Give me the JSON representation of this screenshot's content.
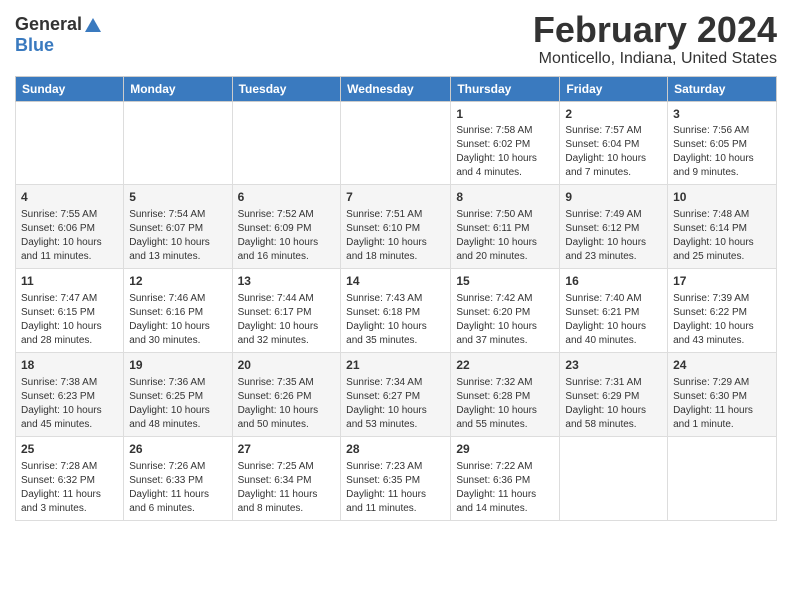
{
  "logo": {
    "general": "General",
    "blue": "Blue"
  },
  "title": "February 2024",
  "subtitle": "Monticello, Indiana, United States",
  "days_of_week": [
    "Sunday",
    "Monday",
    "Tuesday",
    "Wednesday",
    "Thursday",
    "Friday",
    "Saturday"
  ],
  "weeks": [
    [
      {
        "day": "",
        "info": ""
      },
      {
        "day": "",
        "info": ""
      },
      {
        "day": "",
        "info": ""
      },
      {
        "day": "",
        "info": ""
      },
      {
        "day": "1",
        "info": "Sunrise: 7:58 AM\nSunset: 6:02 PM\nDaylight: 10 hours\nand 4 minutes."
      },
      {
        "day": "2",
        "info": "Sunrise: 7:57 AM\nSunset: 6:04 PM\nDaylight: 10 hours\nand 7 minutes."
      },
      {
        "day": "3",
        "info": "Sunrise: 7:56 AM\nSunset: 6:05 PM\nDaylight: 10 hours\nand 9 minutes."
      }
    ],
    [
      {
        "day": "4",
        "info": "Sunrise: 7:55 AM\nSunset: 6:06 PM\nDaylight: 10 hours\nand 11 minutes."
      },
      {
        "day": "5",
        "info": "Sunrise: 7:54 AM\nSunset: 6:07 PM\nDaylight: 10 hours\nand 13 minutes."
      },
      {
        "day": "6",
        "info": "Sunrise: 7:52 AM\nSunset: 6:09 PM\nDaylight: 10 hours\nand 16 minutes."
      },
      {
        "day": "7",
        "info": "Sunrise: 7:51 AM\nSunset: 6:10 PM\nDaylight: 10 hours\nand 18 minutes."
      },
      {
        "day": "8",
        "info": "Sunrise: 7:50 AM\nSunset: 6:11 PM\nDaylight: 10 hours\nand 20 minutes."
      },
      {
        "day": "9",
        "info": "Sunrise: 7:49 AM\nSunset: 6:12 PM\nDaylight: 10 hours\nand 23 minutes."
      },
      {
        "day": "10",
        "info": "Sunrise: 7:48 AM\nSunset: 6:14 PM\nDaylight: 10 hours\nand 25 minutes."
      }
    ],
    [
      {
        "day": "11",
        "info": "Sunrise: 7:47 AM\nSunset: 6:15 PM\nDaylight: 10 hours\nand 28 minutes."
      },
      {
        "day": "12",
        "info": "Sunrise: 7:46 AM\nSunset: 6:16 PM\nDaylight: 10 hours\nand 30 minutes."
      },
      {
        "day": "13",
        "info": "Sunrise: 7:44 AM\nSunset: 6:17 PM\nDaylight: 10 hours\nand 32 minutes."
      },
      {
        "day": "14",
        "info": "Sunrise: 7:43 AM\nSunset: 6:18 PM\nDaylight: 10 hours\nand 35 minutes."
      },
      {
        "day": "15",
        "info": "Sunrise: 7:42 AM\nSunset: 6:20 PM\nDaylight: 10 hours\nand 37 minutes."
      },
      {
        "day": "16",
        "info": "Sunrise: 7:40 AM\nSunset: 6:21 PM\nDaylight: 10 hours\nand 40 minutes."
      },
      {
        "day": "17",
        "info": "Sunrise: 7:39 AM\nSunset: 6:22 PM\nDaylight: 10 hours\nand 43 minutes."
      }
    ],
    [
      {
        "day": "18",
        "info": "Sunrise: 7:38 AM\nSunset: 6:23 PM\nDaylight: 10 hours\nand 45 minutes."
      },
      {
        "day": "19",
        "info": "Sunrise: 7:36 AM\nSunset: 6:25 PM\nDaylight: 10 hours\nand 48 minutes."
      },
      {
        "day": "20",
        "info": "Sunrise: 7:35 AM\nSunset: 6:26 PM\nDaylight: 10 hours\nand 50 minutes."
      },
      {
        "day": "21",
        "info": "Sunrise: 7:34 AM\nSunset: 6:27 PM\nDaylight: 10 hours\nand 53 minutes."
      },
      {
        "day": "22",
        "info": "Sunrise: 7:32 AM\nSunset: 6:28 PM\nDaylight: 10 hours\nand 55 minutes."
      },
      {
        "day": "23",
        "info": "Sunrise: 7:31 AM\nSunset: 6:29 PM\nDaylight: 10 hours\nand 58 minutes."
      },
      {
        "day": "24",
        "info": "Sunrise: 7:29 AM\nSunset: 6:30 PM\nDaylight: 11 hours\nand 1 minute."
      }
    ],
    [
      {
        "day": "25",
        "info": "Sunrise: 7:28 AM\nSunset: 6:32 PM\nDaylight: 11 hours\nand 3 minutes."
      },
      {
        "day": "26",
        "info": "Sunrise: 7:26 AM\nSunset: 6:33 PM\nDaylight: 11 hours\nand 6 minutes."
      },
      {
        "day": "27",
        "info": "Sunrise: 7:25 AM\nSunset: 6:34 PM\nDaylight: 11 hours\nand 8 minutes."
      },
      {
        "day": "28",
        "info": "Sunrise: 7:23 AM\nSunset: 6:35 PM\nDaylight: 11 hours\nand 11 minutes."
      },
      {
        "day": "29",
        "info": "Sunrise: 7:22 AM\nSunset: 6:36 PM\nDaylight: 11 hours\nand 14 minutes."
      },
      {
        "day": "",
        "info": ""
      },
      {
        "day": "",
        "info": ""
      }
    ]
  ]
}
